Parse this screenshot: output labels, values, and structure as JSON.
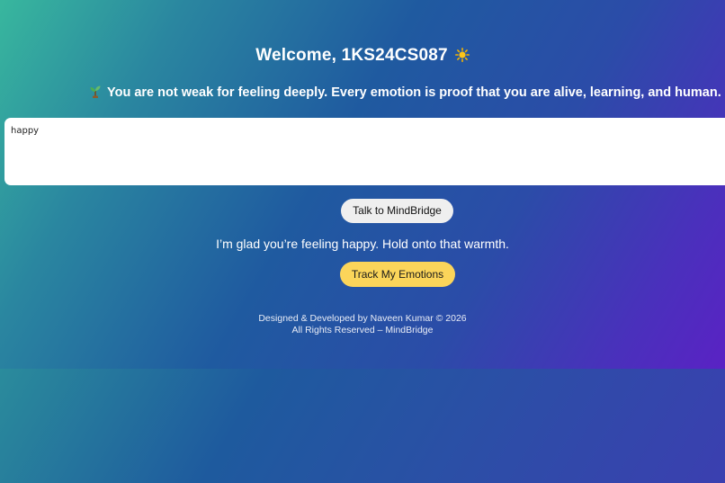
{
  "header": {
    "welcome": "Welcome, 1KS24CS087",
    "welcome_icon": "sun-icon"
  },
  "quote": {
    "icon": "sprout-icon",
    "text": "You are not weak for feeling deeply. Every emotion is proof that you are alive, learning, and human."
  },
  "input": {
    "value": "happy"
  },
  "buttons": {
    "talk_label": "Talk to MindBridge",
    "track_label": "Track My Emotions"
  },
  "response": {
    "text": "I’m glad you’re feeling happy. Hold onto that warmth."
  },
  "footer": {
    "line1": "Designed & Developed by Naveen Kumar © 2026",
    "line2": "All Rights Reserved – MindBridge"
  },
  "colors": {
    "track_button": "#fbd55a",
    "talk_button": "#efefef",
    "gradient_start": "#38b79e",
    "gradient_end": "#5a22c4"
  }
}
